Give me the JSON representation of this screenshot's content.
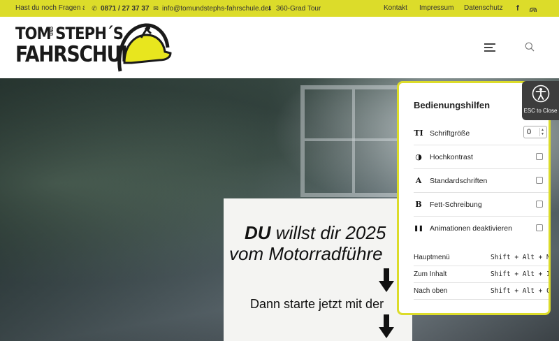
{
  "topbar": {
    "question": "Hast du noch Fragen an u",
    "phone": "0871 / 27 37 37",
    "email": "info@tomundstephs-fahrschule.de",
    "tour": "360-Grad Tour",
    "nav": [
      "Kontakt",
      "Impressum",
      "Datenschutz"
    ],
    "icons": [
      "phone-icon",
      "mail-icon",
      "download-icon",
      "facebook-icon",
      "instagram-icon"
    ]
  },
  "logo": {
    "line1": "TOM  STEPH´S",
    "und": "UND",
    "line2": "FAHRSCHULE!"
  },
  "hero": {
    "poster_line1_bold": "DU",
    "poster_line1_rest": " willst dir 2025",
    "poster_line2": "vom Motorradführe",
    "poster_line3": "Dann starte jetzt mit der"
  },
  "a11y": {
    "title": "Bedienungshilfen",
    "font_size_label": "Schriftgröße",
    "font_size_value": "0",
    "font_size_icon": "TI",
    "options": [
      {
        "icon": "◑",
        "icon_name": "contrast-icon",
        "label": "Hochkontrast"
      },
      {
        "icon": "A",
        "icon_name": "font-icon",
        "label": "Standardschriften"
      },
      {
        "icon": "B",
        "icon_name": "bold-icon",
        "label": "Fett-Schreibung"
      },
      {
        "icon": "❚❚",
        "icon_name": "pause-icon",
        "label": "Animationen deaktivieren"
      }
    ],
    "shortcuts": [
      {
        "label": "Hauptmenü",
        "keys": "Shift + Alt + M"
      },
      {
        "label": "Zum Inhalt",
        "keys": "Shift + Alt + I"
      },
      {
        "label": "Nach oben",
        "keys": "Shift + Alt + O"
      }
    ],
    "esc_label": "ESC to Close"
  },
  "colors": {
    "brand_yellow": "#dcdc2a",
    "dark": "#3d3d3d"
  }
}
